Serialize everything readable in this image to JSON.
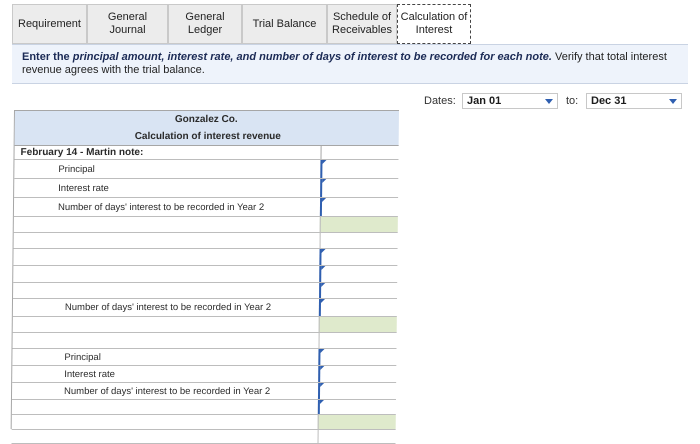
{
  "tabs": [
    {
      "label": "Requirement",
      "active": false
    },
    {
      "label": "General\nJournal",
      "active": false
    },
    {
      "label": "General\nLedger",
      "active": false
    },
    {
      "label": "Trial Balance",
      "active": false
    },
    {
      "label": "Schedule of\nReceivables",
      "active": false
    },
    {
      "label": "Calculation of\nInterest",
      "active": true
    }
  ],
  "instruction": {
    "lead": "Enter the ",
    "b1": "principal amount, interest rate, and number of days of interest",
    "mid": " to be recorded for each note.",
    "tail": " Verify that total interest revenue agrees with the trial balance."
  },
  "dates": {
    "label": "Dates:",
    "from": "Jan 01",
    "to_label": "to:",
    "to": "Dec 31"
  },
  "table": {
    "company": "Gonzalez Co.",
    "subtitle": "Calculation of interest revenue",
    "rows": [
      {
        "text": "February 14 - Martin note:",
        "bold": true,
        "indent": 0,
        "cell": "none"
      },
      {
        "text": "Principal",
        "bold": false,
        "indent": 1,
        "cell": "input"
      },
      {
        "text": "Interest rate",
        "bold": false,
        "indent": 1,
        "cell": "input"
      },
      {
        "text": "Number of days' interest to be recorded in Year 2",
        "bold": false,
        "indent": 1,
        "cell": "input"
      },
      {
        "text": "",
        "bold": false,
        "indent": 0,
        "cell": "green"
      },
      {
        "text": "",
        "bold": false,
        "indent": 0,
        "cell": "plain"
      },
      {
        "text": "",
        "bold": false,
        "indent": 0,
        "cell": "input"
      },
      {
        "text": "",
        "bold": false,
        "indent": 0,
        "cell": "input"
      },
      {
        "text": "",
        "bold": false,
        "indent": 0,
        "cell": "input"
      },
      {
        "text": "Number of days' interest to be recorded in Year 2",
        "bold": false,
        "indent": 2,
        "cell": "input"
      },
      {
        "text": "",
        "bold": false,
        "indent": 0,
        "cell": "green"
      },
      {
        "text": "",
        "bold": false,
        "indent": 0,
        "cell": "plain"
      },
      {
        "text": "Principal",
        "bold": false,
        "indent": 2,
        "cell": "input"
      },
      {
        "text": "Interest rate",
        "bold": false,
        "indent": 2,
        "cell": "input"
      },
      {
        "text": "Number of days' interest to be recorded in Year 2",
        "bold": false,
        "indent": 2,
        "cell": "input"
      },
      {
        "text": "",
        "bold": false,
        "indent": 0,
        "cell": "input"
      },
      {
        "text": "",
        "bold": false,
        "indent": 0,
        "cell": "green"
      },
      {
        "text": "",
        "bold": false,
        "indent": 0,
        "cell": "plain"
      }
    ]
  },
  "colors": {
    "accent": "#2f5fb0",
    "header_bg": "#d9e4f3",
    "total_cell": "#dfeacc"
  }
}
